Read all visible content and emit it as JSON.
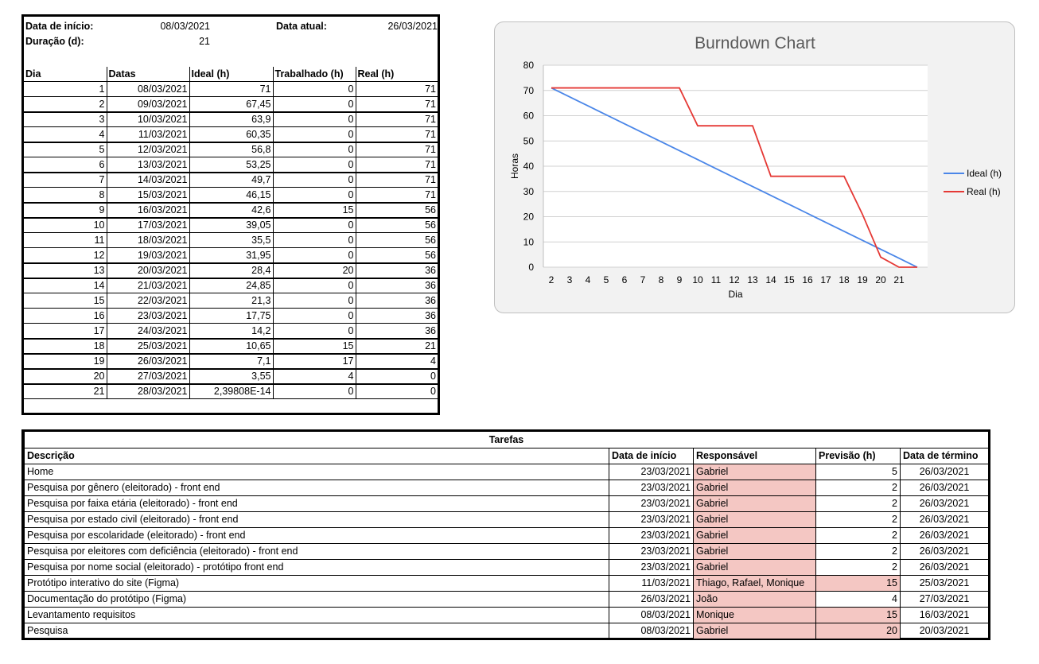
{
  "summary": {
    "start_label": "Data de início:",
    "start_value": "08/03/2021",
    "duration_label": "Duração (d):",
    "duration_value": "21",
    "current_label": "Data atual:",
    "current_value": "26/03/2021",
    "columns": [
      "Dia",
      "Datas",
      "Ideal (h)",
      "Trabalhado (h)",
      "Real (h)"
    ],
    "rows": [
      [
        "1",
        "08/03/2021",
        "71",
        "0",
        "71"
      ],
      [
        "2",
        "09/03/2021",
        "67,45",
        "0",
        "71"
      ],
      [
        "3",
        "10/03/2021",
        "63,9",
        "0",
        "71"
      ],
      [
        "4",
        "11/03/2021",
        "60,35",
        "0",
        "71"
      ],
      [
        "5",
        "12/03/2021",
        "56,8",
        "0",
        "71"
      ],
      [
        "6",
        "13/03/2021",
        "53,25",
        "0",
        "71"
      ],
      [
        "7",
        "14/03/2021",
        "49,7",
        "0",
        "71"
      ],
      [
        "8",
        "15/03/2021",
        "46,15",
        "0",
        "71"
      ],
      [
        "9",
        "16/03/2021",
        "42,6",
        "15",
        "56"
      ],
      [
        "10",
        "17/03/2021",
        "39,05",
        "0",
        "56"
      ],
      [
        "11",
        "18/03/2021",
        "35,5",
        "0",
        "56"
      ],
      [
        "12",
        "19/03/2021",
        "31,95",
        "0",
        "56"
      ],
      [
        "13",
        "20/03/2021",
        "28,4",
        "20",
        "36"
      ],
      [
        "14",
        "21/03/2021",
        "24,85",
        "0",
        "36"
      ],
      [
        "15",
        "22/03/2021",
        "21,3",
        "0",
        "36"
      ],
      [
        "16",
        "23/03/2021",
        "17,75",
        "0",
        "36"
      ],
      [
        "17",
        "24/03/2021",
        "14,2",
        "0",
        "36"
      ],
      [
        "18",
        "25/03/2021",
        "10,65",
        "15",
        "21"
      ],
      [
        "19",
        "26/03/2021",
        "7,1",
        "17",
        "4"
      ],
      [
        "20",
        "27/03/2021",
        "3,55",
        "4",
        "0"
      ],
      [
        "21",
        "28/03/2021",
        "2,39808E-14",
        "0",
        "0"
      ]
    ]
  },
  "chart_data": {
    "type": "line",
    "title": "Burndown Chart",
    "xlabel": "Dia",
    "ylabel": "Horas",
    "x_ticks": [
      "2",
      "3",
      "4",
      "5",
      "6",
      "7",
      "8",
      "9",
      "10",
      "11",
      "12",
      "13",
      "14",
      "15",
      "16",
      "17",
      "18",
      "19",
      "20",
      "21"
    ],
    "y_ticks": [
      "0",
      "10",
      "20",
      "30",
      "40",
      "50",
      "60",
      "70",
      "80"
    ],
    "ylim": [
      0,
      80
    ],
    "grid": true,
    "legend_position": "right",
    "series": [
      {
        "name": "Ideal (h)",
        "color": "#4a86e8",
        "values": [
          71,
          67.45,
          63.9,
          60.35,
          56.8,
          53.25,
          49.7,
          46.15,
          42.6,
          39.05,
          35.5,
          31.95,
          28.4,
          24.85,
          21.3,
          17.75,
          14.2,
          10.65,
          7.1,
          3.55,
          0
        ]
      },
      {
        "name": "Real (h)",
        "color": "#e53935",
        "values": [
          71,
          71,
          71,
          71,
          71,
          71,
          71,
          71,
          56,
          56,
          56,
          56,
          36,
          36,
          36,
          36,
          36,
          21,
          4,
          0,
          0
        ]
      }
    ]
  },
  "tasks": {
    "title": "Tarefas",
    "columns": [
      "Descrição",
      "Data de início",
      "Responsável",
      "Previsão (h)",
      "Data de término"
    ],
    "rows": [
      {
        "desc": "Home",
        "start": "23/03/2021",
        "owner": "Gabriel",
        "hours": "5",
        "end": "26/03/2021",
        "hours_pink": false
      },
      {
        "desc": "Pesquisa por gênero (eleitorado)  -  front end",
        "start": "23/03/2021",
        "owner": "Gabriel",
        "hours": "2",
        "end": "26/03/2021",
        "hours_pink": false
      },
      {
        "desc": "Pesquisa por faixa etária (eleitorado)  -  front end",
        "start": "23/03/2021",
        "owner": "Gabriel",
        "hours": "2",
        "end": "26/03/2021",
        "hours_pink": false
      },
      {
        "desc": "Pesquisa por estado civil (eleitorado)  -   front end",
        "start": "23/03/2021",
        "owner": "Gabriel",
        "hours": "2",
        "end": "26/03/2021",
        "hours_pink": false
      },
      {
        "desc": "Pesquisa por escolaridade (eleitorado)  - front end",
        "start": "23/03/2021",
        "owner": "Gabriel",
        "hours": "2",
        "end": "26/03/2021",
        "hours_pink": false
      },
      {
        "desc": "Pesquisa por eleitores com deficiência (eleitorado) - front end",
        "start": "23/03/2021",
        "owner": "Gabriel",
        "hours": "2",
        "end": "26/03/2021",
        "hours_pink": false
      },
      {
        "desc": "Pesquisa por nome social (eleitorado)  -  protótipo front end",
        "start": "23/03/2021",
        "owner": "Gabriel",
        "hours": "2",
        "end": "26/03/2021",
        "hours_pink": false
      },
      {
        "desc": "Protótipo interativo do site (Figma)",
        "start": "11/03/2021",
        "owner": "Thiago, Rafael, Monique",
        "hours": "15",
        "end": "25/03/2021",
        "hours_pink": true
      },
      {
        "desc": "Documentação do protótipo (Figma)",
        "start": "26/03/2021",
        "owner": "João",
        "hours": "4",
        "end": "27/03/2021",
        "hours_pink": false
      },
      {
        "desc": "Levantamento requisitos",
        "start": "08/03/2021",
        "owner": "Monique",
        "hours": "15",
        "end": "16/03/2021",
        "hours_pink": true
      },
      {
        "desc": "Pesquisa",
        "start": "08/03/2021",
        "owner": "Gabriel",
        "hours": "20",
        "end": "20/03/2021",
        "hours_pink": true
      }
    ]
  }
}
